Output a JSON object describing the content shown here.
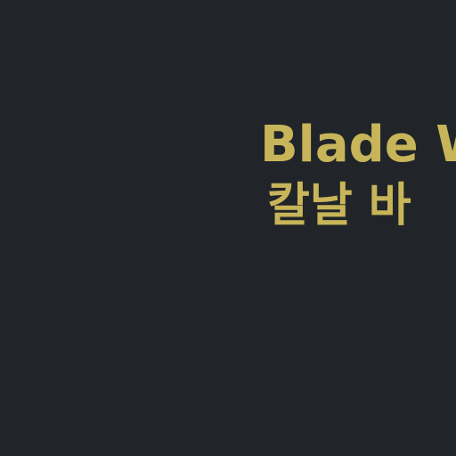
{
  "game": {
    "title_english": "Blade W",
    "title_korean": "칼날 바"
  },
  "colors": {
    "background": "#212529",
    "title_text": "#c8b55a"
  }
}
